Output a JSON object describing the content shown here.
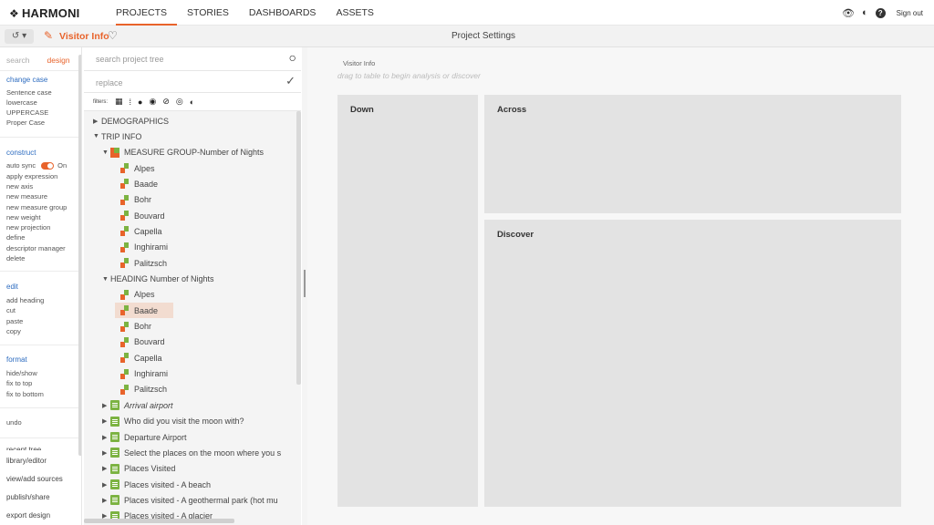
{
  "app": {
    "logo": "HARMONI"
  },
  "nav": {
    "tabs": [
      "PROJECTS",
      "STORIES",
      "DASHBOARDS",
      "ASSETS"
    ],
    "active": 0
  },
  "topright": {
    "signout": "Sign out",
    "help": "?"
  },
  "subbar": {
    "history_icon": "history-icon",
    "title": "Visitor Info",
    "center_title": "Project Settings"
  },
  "commands": {
    "tab_search": "search",
    "tab_design": "design",
    "sections": [
      {
        "heading": "change case",
        "items": [
          "Sentence case",
          "lowercase",
          "UPPERCASE",
          "Proper Case"
        ]
      },
      {
        "heading": "construct",
        "items": [
          "auto sync",
          "apply expression",
          "new axis",
          "new measure",
          "new measure group",
          "new weight",
          "new projection",
          "define",
          "descriptor manager",
          "delete"
        ]
      },
      {
        "heading": "edit",
        "items": [
          "add heading",
          "cut",
          "paste",
          "copy"
        ]
      },
      {
        "heading": "format",
        "items": [
          "hide/show",
          "fix to top",
          "fix to bottom"
        ]
      },
      {
        "heading": "",
        "items": [
          "undo"
        ]
      }
    ],
    "auto_sync_state": "On",
    "bottom_links": [
      "recent tree",
      "library/editor",
      "view/add sources",
      "publish/share",
      "export design"
    ]
  },
  "tree": {
    "search_placeholder": "search project tree",
    "replace_placeholder": "replace",
    "filters_label": "filters:",
    "nodes": [
      {
        "label": "DEMOGRAPHICS",
        "level": 0,
        "arrow": "right",
        "icon": "none"
      },
      {
        "label": "TRIP INFO",
        "level": 0,
        "arrow": "down",
        "icon": "none"
      },
      {
        "label": "MEASURE GROUP-Number of Nights",
        "level": 1,
        "arrow": "down",
        "icon": "measure"
      },
      {
        "label": "Alpes",
        "level": 2,
        "icon": "leaf"
      },
      {
        "label": "Baade",
        "level": 2,
        "icon": "leaf"
      },
      {
        "label": "Bohr",
        "level": 2,
        "icon": "leaf"
      },
      {
        "label": "Bouvard",
        "level": 2,
        "icon": "leaf"
      },
      {
        "label": "Capella",
        "level": 2,
        "icon": "leaf"
      },
      {
        "label": "Inghirami",
        "level": 2,
        "icon": "leaf"
      },
      {
        "label": "Palitzsch",
        "level": 2,
        "icon": "leaf"
      },
      {
        "label": "HEADING Number of Nights",
        "level": 1,
        "arrow": "down",
        "icon": "none"
      },
      {
        "label": "Alpes",
        "level": 2,
        "icon": "leaf"
      },
      {
        "label": "Baade",
        "level": 2,
        "icon": "leaf",
        "selected": true
      },
      {
        "label": "Bohr",
        "level": 2,
        "icon": "leaf"
      },
      {
        "label": "Bouvard",
        "level": 2,
        "icon": "leaf"
      },
      {
        "label": "Capella",
        "level": 2,
        "icon": "leaf"
      },
      {
        "label": "Inghirami",
        "level": 2,
        "icon": "leaf"
      },
      {
        "label": "Palitzsch",
        "level": 2,
        "icon": "leaf"
      },
      {
        "label": "Arrival airport",
        "level": 1,
        "arrow": "right",
        "icon": "list",
        "italic": true
      },
      {
        "label": "Who did you visit the moon with?",
        "level": 1,
        "arrow": "right",
        "icon": "list"
      },
      {
        "label": "Departure Airport",
        "level": 1,
        "arrow": "right",
        "icon": "list"
      },
      {
        "label": "Select the places on the moon where you s",
        "level": 1,
        "arrow": "right",
        "icon": "list"
      },
      {
        "label": "Places Visited",
        "level": 1,
        "arrow": "right",
        "icon": "list"
      },
      {
        "label": "Places visited - A beach",
        "level": 1,
        "arrow": "right",
        "icon": "list"
      },
      {
        "label": "Places visited - A geothermal park (hot mu",
        "level": 1,
        "arrow": "right",
        "icon": "list"
      },
      {
        "label": "Places visited - A glacier",
        "level": 1,
        "arrow": "right",
        "icon": "list"
      }
    ]
  },
  "canvas": {
    "breadcrumb": "Visitor Info",
    "hint": "drag to table to begin analysis or discover",
    "zones": {
      "down": "Down",
      "across": "Across",
      "discover": "Discover"
    }
  },
  "colors": {
    "accent": "#e8632b",
    "link": "#2d6cc0",
    "green": "#7cb342"
  }
}
